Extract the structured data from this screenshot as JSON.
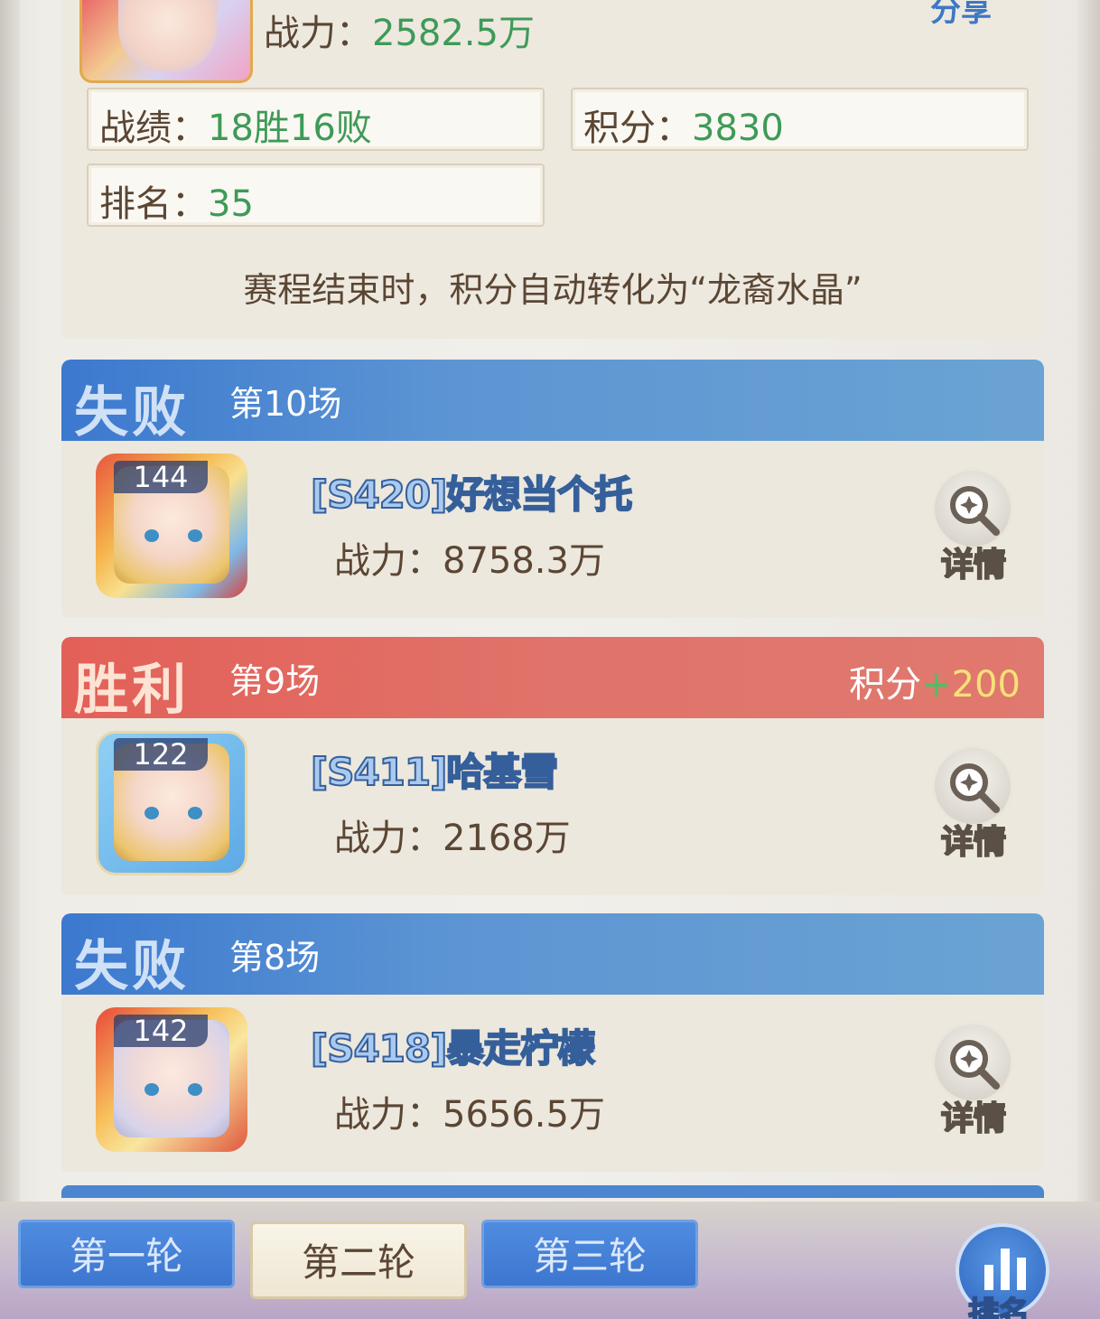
{
  "header": {
    "power_label": "战力：",
    "power_value": "2582.5万",
    "share_label": "分享"
  },
  "stats": {
    "record_label": "战绩：",
    "record_value": "18胜16败",
    "points_label": "积分：",
    "points_value": "3830",
    "rank_label": "排名：",
    "rank_value": "35"
  },
  "note": "赛程结束时，积分自动转化为“龙裔水晶”",
  "matches": [
    {
      "result": "失败",
      "round": "第10场",
      "score_label": "",
      "level": "144",
      "name": "[S420]好想当个托",
      "power_label": "战力：",
      "power_value": "8758.3万",
      "detail_label": "详情"
    },
    {
      "result": "胜利",
      "round": "第9场",
      "score_label": "积分",
      "score_plus": "+",
      "score_value": "200",
      "level": "122",
      "name": "[S411]哈基雪",
      "power_label": "战力：",
      "power_value": "2168万",
      "detail_label": "详情"
    },
    {
      "result": "失败",
      "round": "第8场",
      "score_label": "",
      "level": "142",
      "name": "[S418]暴走柠檬",
      "power_label": "战力：",
      "power_value": "5656.5万",
      "detail_label": "详情"
    }
  ],
  "tabs": [
    {
      "label": "第一轮",
      "active": false
    },
    {
      "label": "第二轮",
      "active": true
    },
    {
      "label": "第三轮",
      "active": false
    }
  ],
  "rank_button_label": "排名",
  "colors": {
    "lose_bar": "#3c79cf",
    "win_bar": "#e36058",
    "value_green": "#3e9a58",
    "text_brown": "#5b4634"
  }
}
